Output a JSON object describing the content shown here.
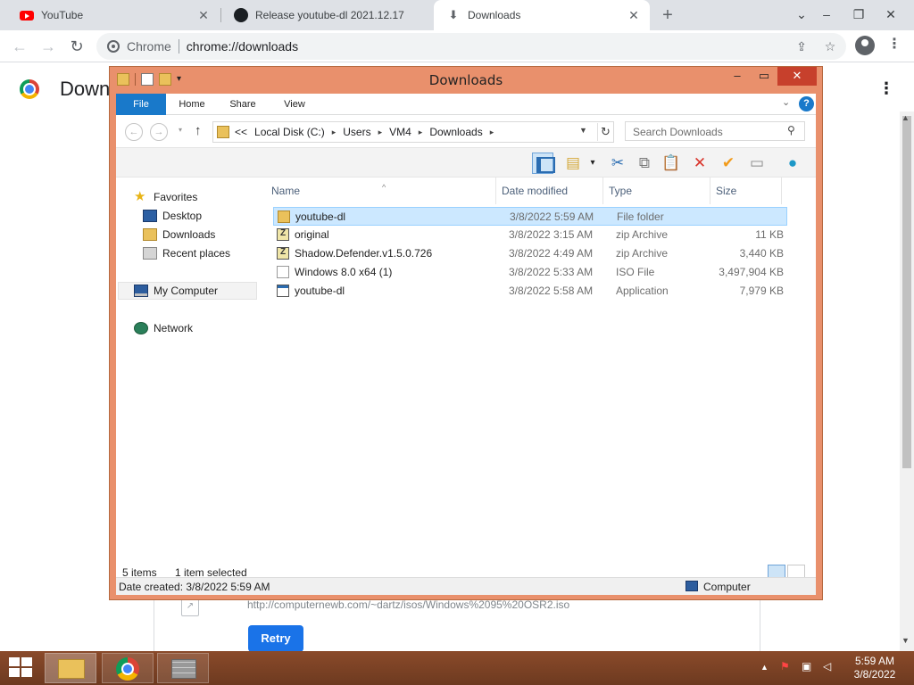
{
  "chrome": {
    "tabs": [
      {
        "title": "YouTube"
      },
      {
        "title": "Release youtube-dl 2021.12.17"
      },
      {
        "title": "Downloads"
      }
    ],
    "omnibox": {
      "origin": "Chrome",
      "url": "chrome://downloads"
    }
  },
  "downloads_page": {
    "title": "Down",
    "card_url": "http://computernewb.com/~dartz/isos/Windows%2095%20OSR2.iso",
    "retry_label": "Retry"
  },
  "explorer": {
    "title": "Downloads",
    "ribbon_tabs": [
      "File",
      "Home",
      "Share",
      "View"
    ],
    "breadcrumb": [
      "<<",
      "Local Disk (C:)",
      "Users",
      "VM4",
      "Downloads"
    ],
    "search_placeholder": "Search Downloads",
    "nav": {
      "favorites": "Favorites",
      "desktop": "Desktop",
      "downloads": "Downloads",
      "recent": "Recent places",
      "computer": "My Computer",
      "network": "Network"
    },
    "columns": {
      "name": "Name",
      "date": "Date modified",
      "type": "Type",
      "size": "Size"
    },
    "files": [
      {
        "name": "youtube-dl",
        "date": "3/8/2022 5:59 AM",
        "type": "File folder",
        "size": "",
        "icon": "folder"
      },
      {
        "name": "original",
        "date": "3/8/2022 3:15 AM",
        "type": "zip Archive",
        "size": "11 KB",
        "icon": "zip"
      },
      {
        "name": "Shadow.Defender.v1.5.0.726",
        "date": "3/8/2022 4:49 AM",
        "type": "zip Archive",
        "size": "3,440 KB",
        "icon": "zip"
      },
      {
        "name": "Windows 8.0 x64 (1)",
        "date": "3/8/2022 5:33 AM",
        "type": "ISO File",
        "size": "3,497,904 KB",
        "icon": "iso"
      },
      {
        "name": "youtube-dl",
        "date": "3/8/2022 5:58 AM",
        "type": "Application",
        "size": "7,979 KB",
        "icon": "app"
      }
    ],
    "status": {
      "items": "5 items",
      "selected": "1 item selected"
    },
    "details": {
      "created": "Date created: 3/8/2022 5:59 AM",
      "location": "Computer"
    }
  },
  "taskbar": {
    "time": "5:59 AM",
    "date": "3/8/2022"
  }
}
